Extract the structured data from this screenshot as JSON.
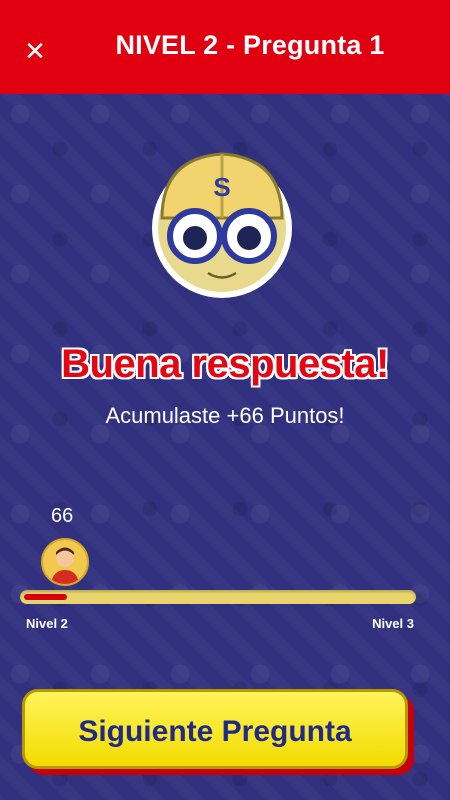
{
  "header": {
    "close_icon": "close-icon",
    "title": "NIVEL 2 - Pregunta 1"
  },
  "mascot": {
    "icon": "helmet-mascot",
    "helmet_letter": "S"
  },
  "result": {
    "title": "Buena respuesta!",
    "subtitle": "Acumulaste +66 Puntos!"
  },
  "progress": {
    "points": "66",
    "fraction": 0.11,
    "level_start": "Nivel 2",
    "level_end": "Nivel 3"
  },
  "actions": {
    "next_label": "Siguiente Pregunta"
  },
  "colors": {
    "header": "#e1000f",
    "background": "#2f2f7e",
    "button": "#f2dc00",
    "button_text": "#1f2a8a",
    "accent_red": "#e30613"
  }
}
